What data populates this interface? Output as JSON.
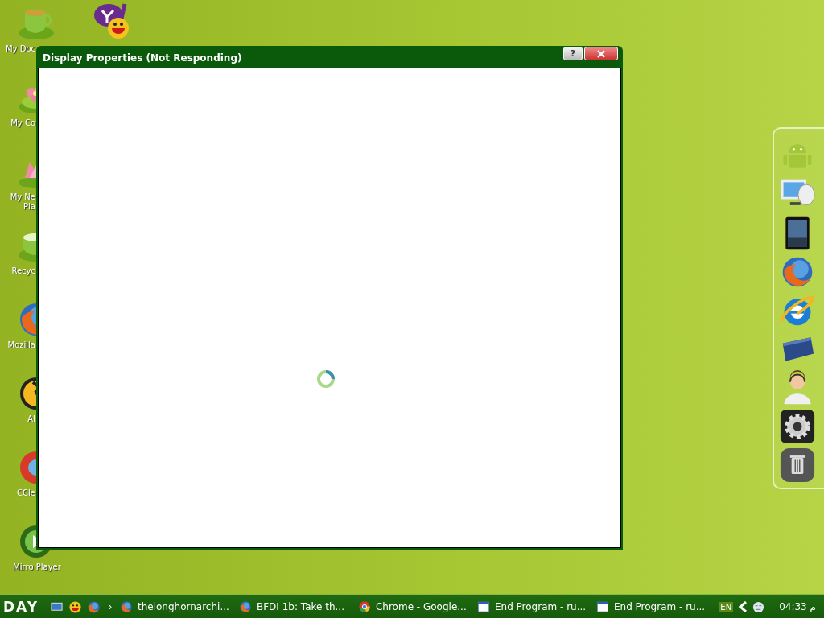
{
  "desktop_icons": [
    {
      "kind": "cup",
      "label_lines": [
        "My Doc"
      ]
    },
    {
      "kind": "flower",
      "label_lines": [
        "My Co"
      ]
    },
    {
      "kind": "lotus",
      "label_lines": [
        "My Ne",
        "Pla"
      ]
    },
    {
      "kind": "bin",
      "label_lines": [
        "Recyc"
      ]
    },
    {
      "kind": "firefox",
      "label_lines": [
        "Mozilla"
      ]
    },
    {
      "kind": "aim",
      "label_lines": [
        "AI"
      ]
    },
    {
      "kind": "ccleaner",
      "label_lines": [
        "CCle"
      ]
    },
    {
      "kind": "player",
      "label_lines": [
        "Mirro Player"
      ]
    },
    {
      "kind": "yahoo"
    }
  ],
  "window": {
    "title": "Display Properties (Not Responding)",
    "help_button": "?"
  },
  "taskbar": {
    "start": "DAY",
    "quick_launch": [
      {
        "kind": "desktop"
      },
      {
        "kind": "smiley"
      },
      {
        "kind": "firefox"
      }
    ],
    "more": "›",
    "tasks": [
      {
        "kind": "firefox",
        "label": "thelonghornarchi..."
      },
      {
        "kind": "firefox",
        "label": "BFDI 1b: Take th..."
      },
      {
        "kind": "chrome",
        "label": "Chrome - Google..."
      },
      {
        "kind": "window",
        "label": "End Program - ru..."
      },
      {
        "kind": "window",
        "label": "End Program - ru..."
      }
    ],
    "language": "EN",
    "clock": "04:33 م"
  },
  "dock": [
    {
      "kind": "android"
    },
    {
      "kind": "monitor"
    },
    {
      "kind": "tablet"
    },
    {
      "kind": "firefox"
    },
    {
      "kind": "ie"
    },
    {
      "kind": "facebook"
    },
    {
      "kind": "support"
    },
    {
      "kind": "gear"
    },
    {
      "kind": "trash"
    }
  ]
}
